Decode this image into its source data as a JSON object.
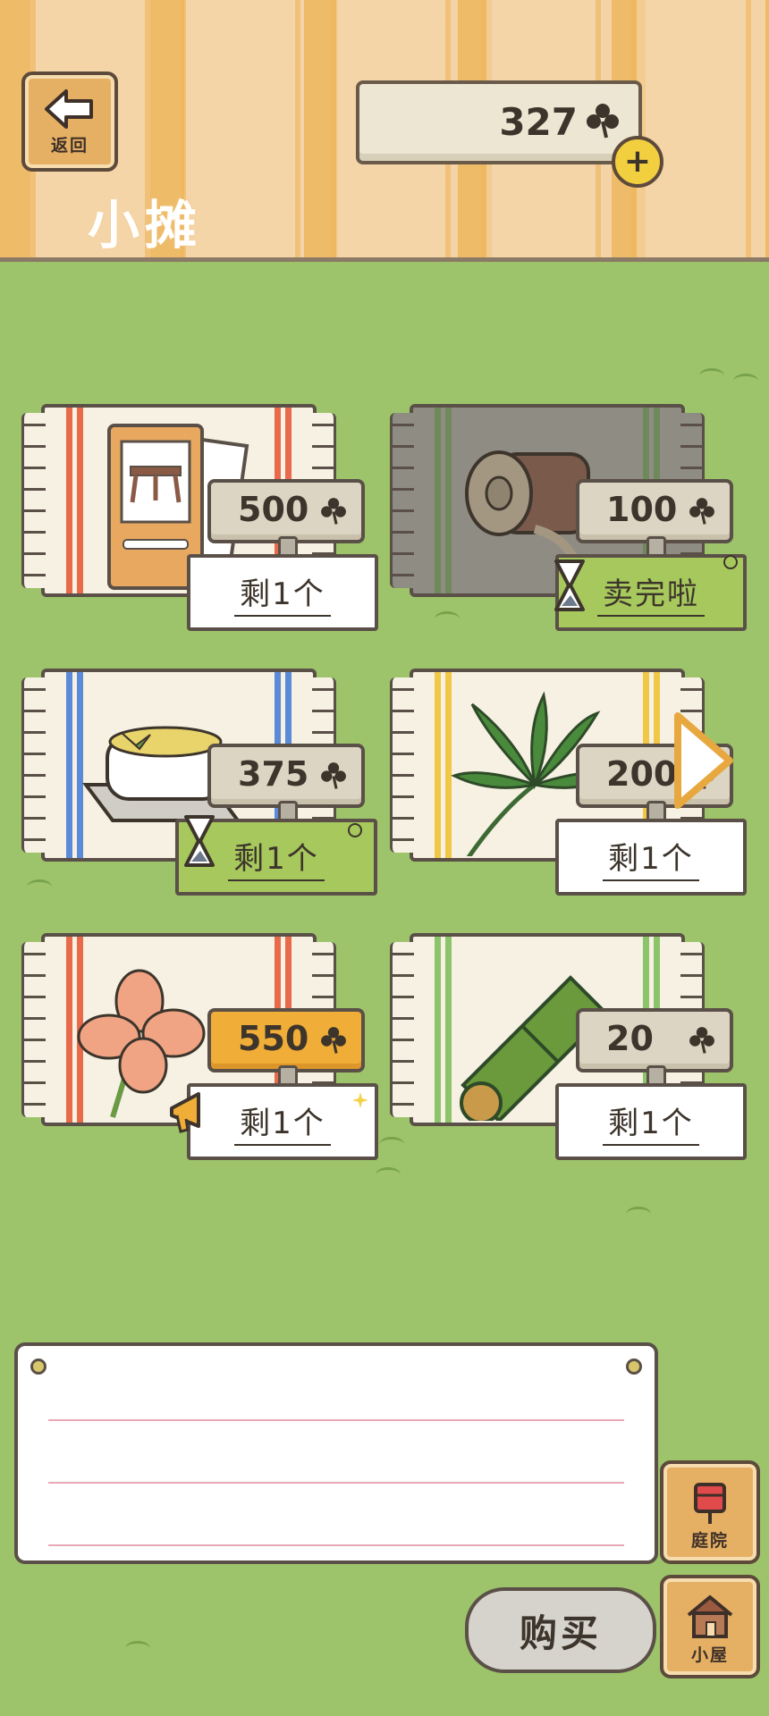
{
  "header": {
    "back_label": "返回",
    "title": "小摊",
    "coins": "327"
  },
  "items": [
    {
      "price": "500",
      "label": "剩1个",
      "price_style": "normal",
      "status": "normal",
      "art": "table-photo"
    },
    {
      "price": "100",
      "label": "卖完啦",
      "price_style": "normal",
      "status": "timed",
      "art": "bamboo-drum"
    },
    {
      "price": "375",
      "label": "剩1个",
      "price_style": "normal",
      "status": "timed",
      "art": "pudding-dish"
    },
    {
      "price": "200",
      "label": "剩1个",
      "price_style": "normal",
      "status": "normal",
      "art": "palm-leaf"
    },
    {
      "price": "550",
      "label": "剩1个",
      "price_style": "gold",
      "status": "promo",
      "art": "four-leaf-clover"
    },
    {
      "price": "20",
      "label": "剩1个",
      "price_style": "normal",
      "status": "normal",
      "art": "bamboo-tube"
    }
  ],
  "message": "",
  "nav": {
    "yard_label": "庭院",
    "house_label": "小屋",
    "buy_label": "购买"
  },
  "colors": {
    "grass": "#9dc46a",
    "stripe_gold": "#eebc68",
    "stripe_cream": "#f4d3a6",
    "gold_tag": "#f0ad37",
    "sold_out_green": "#a6c85c"
  }
}
